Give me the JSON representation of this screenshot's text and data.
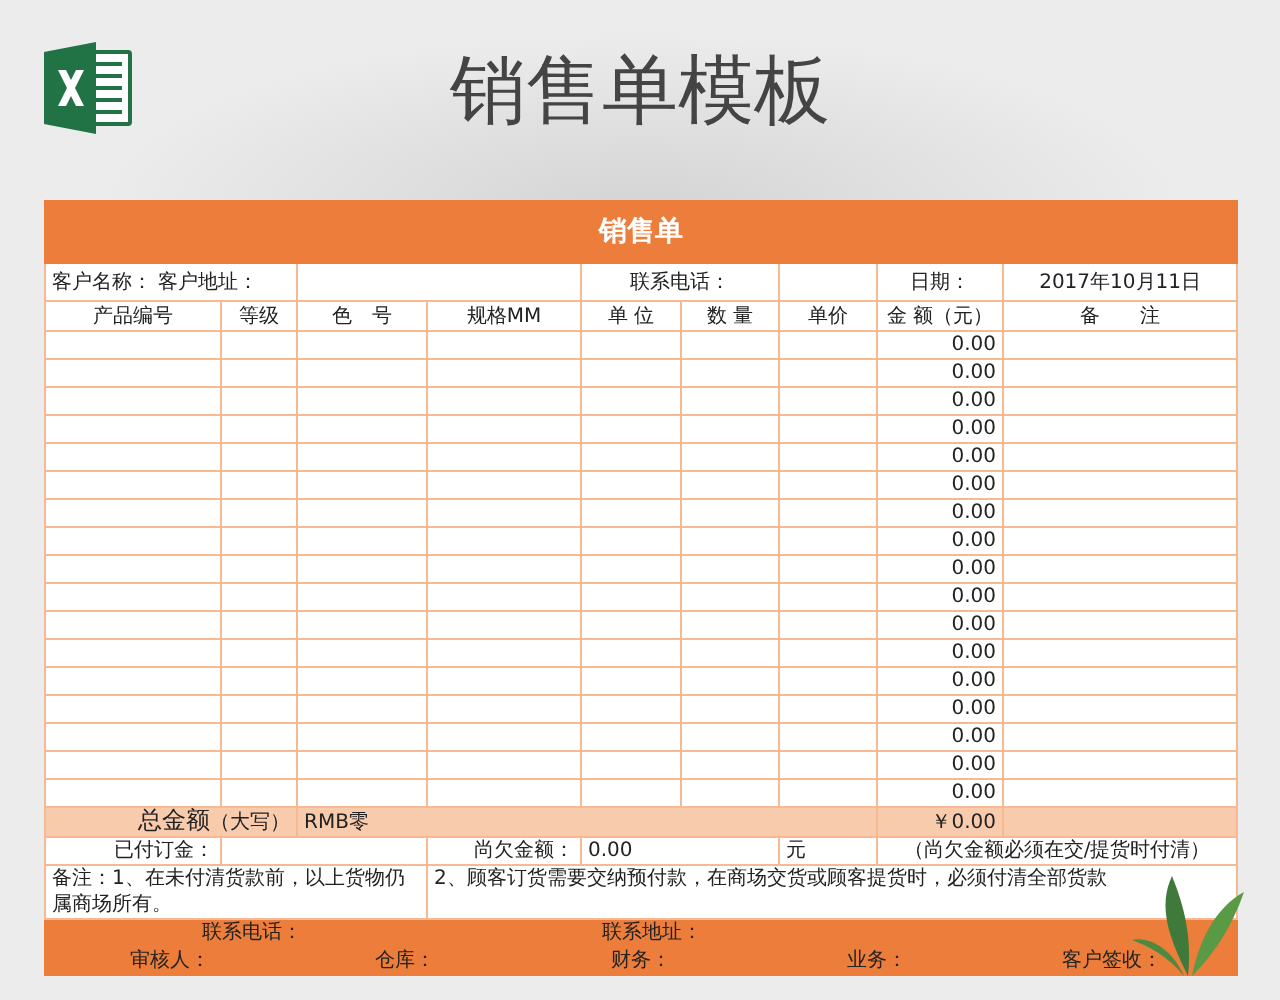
{
  "page_title": "销售单模板",
  "sheet": {
    "title": "销售单",
    "info": {
      "customer_name_label": "客户名称：",
      "customer_address_label": "客户地址：",
      "phone_label": "联系电话：",
      "date_label": "日期：",
      "date": "2017年10月11日"
    },
    "columns": [
      "产品编号",
      "等级",
      "色　号",
      "规格MM",
      "单 位",
      "数 量",
      "单价",
      "金 额（元）",
      "备　　注"
    ],
    "rows": [
      {
        "amount": "0.00"
      },
      {
        "amount": "0.00"
      },
      {
        "amount": "0.00"
      },
      {
        "amount": "0.00"
      },
      {
        "amount": "0.00"
      },
      {
        "amount": "0.00"
      },
      {
        "amount": "0.00"
      },
      {
        "amount": "0.00"
      },
      {
        "amount": "0.00"
      },
      {
        "amount": "0.00"
      },
      {
        "amount": "0.00"
      },
      {
        "amount": "0.00"
      },
      {
        "amount": "0.00"
      },
      {
        "amount": "0.00"
      },
      {
        "amount": "0.00"
      },
      {
        "amount": "0.00"
      },
      {
        "amount": "0.00"
      }
    ],
    "total": {
      "label": "总金额",
      "sublabel": "（大写）",
      "words": "RMB零",
      "amount": "￥0.00"
    },
    "paid": {
      "deposit_label": "已付订金：",
      "owed_label": "尚欠金额：",
      "owed": "0.00",
      "unit": "元",
      "note": "（尚欠金额必须在交/提货时付清）"
    },
    "notes": [
      "备注：1、在未付清货款前，以上货物仍属商场所有。",
      "2、顾客订货需要交纳预付款，在商场交货或顾客提货时，必须付清全部货款"
    ],
    "footer": [
      [
        "联系电话：",
        "联系地址："
      ],
      [
        "审核人：",
        "仓库：",
        "财务：",
        "业务：",
        "客户签收："
      ]
    ]
  }
}
